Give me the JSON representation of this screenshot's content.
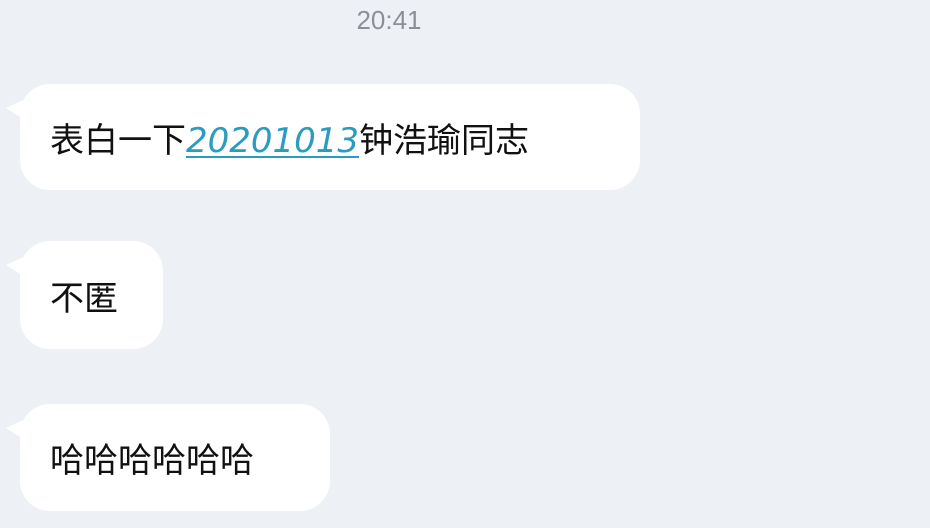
{
  "chat": {
    "timestamp": "20:41",
    "messages": [
      {
        "prefix": "表白一下",
        "link": "20201013",
        "suffix": "钟浩瑜同志"
      },
      {
        "text": "不匿"
      },
      {
        "text": "哈哈哈哈哈哈"
      }
    ]
  },
  "colors": {
    "background": "#edf1f5",
    "bubble": "#ffffff",
    "link": "#2a9bc1",
    "timestamp": "#8c9096"
  }
}
